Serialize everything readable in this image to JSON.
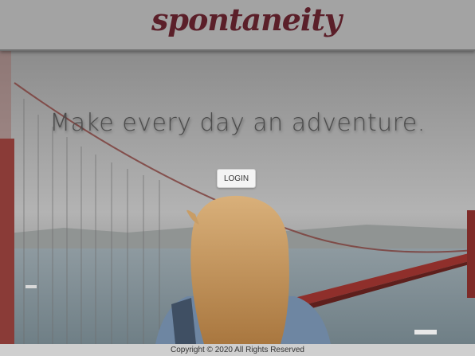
{
  "header": {
    "brand": "spontaneity"
  },
  "hero": {
    "tagline": "Make every day an adventure.",
    "background_image": "golden-gate-bridge-photo"
  },
  "actions": {
    "login_label": "LOGIN"
  },
  "footer": {
    "copyright": "Copyright © 2020 All Rights Reserved"
  },
  "colors": {
    "brand": "#5b1f29",
    "header_bg": "#a3a3a3",
    "footer_bg": "#cfcfcf"
  }
}
